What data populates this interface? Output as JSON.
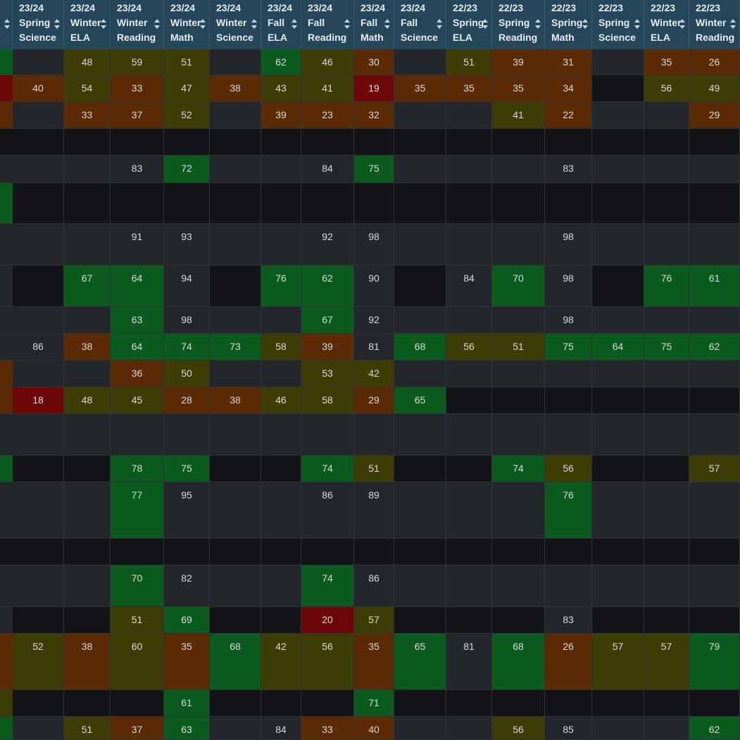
{
  "colors": {
    "empty": "#121417",
    "low": "#6e0808",
    "below": "#5a2b04",
    "mid": "#3f3d06",
    "high": "#0b5b1f",
    "avg": "#23272c",
    "header": "#26465a"
  },
  "columns": [
    {
      "term": "23/24",
      "season": "Spring",
      "subject": "Science"
    },
    {
      "term": "23/24",
      "season": "Winter",
      "subject": "ELA"
    },
    {
      "term": "23/24",
      "season": "Winter",
      "subject": "Reading"
    },
    {
      "term": "23/24",
      "season": "Winter",
      "subject": "Math"
    },
    {
      "term": "23/24",
      "season": "Winter",
      "subject": "Science"
    },
    {
      "term": "23/24",
      "season": "Fall",
      "subject": "ELA"
    },
    {
      "term": "23/24",
      "season": "Fall",
      "subject": "Reading"
    },
    {
      "term": "23/24",
      "season": "Fall",
      "subject": "Math"
    },
    {
      "term": "23/24",
      "season": "Fall",
      "subject": "Science"
    },
    {
      "term": "22/23",
      "season": "Spring",
      "subject": "ELA"
    },
    {
      "term": "22/23",
      "season": "Spring",
      "subject": "Reading"
    },
    {
      "term": "22/23",
      "season": "Spring",
      "subject": "Math"
    },
    {
      "term": "22/23",
      "season": "Spring",
      "subject": "Science"
    },
    {
      "term": "22/23",
      "season": "Winter",
      "subject": "ELA"
    },
    {
      "term": "22/23",
      "season": "Winter",
      "subject": "Reading"
    }
  ],
  "edge": [
    "high",
    "low",
    "below",
    "empty",
    "avg",
    "high",
    "avg",
    "avg",
    "avg",
    "avg",
    "below",
    "below",
    "avg",
    "high",
    "avg",
    "empty",
    "avg",
    "avg",
    "below",
    "mid",
    "high"
  ],
  "rows": [
    [
      [
        "",
        "avg"
      ],
      [
        "48",
        "mid"
      ],
      [
        "59",
        "mid"
      ],
      [
        "51",
        "mid"
      ],
      [
        "",
        "avg"
      ],
      [
        "62",
        "high"
      ],
      [
        "46",
        "mid"
      ],
      [
        "30",
        "below"
      ],
      [
        "",
        "avg"
      ],
      [
        "51",
        "mid"
      ],
      [
        "39",
        "below"
      ],
      [
        "31",
        "below"
      ],
      [
        "",
        "avg"
      ],
      [
        "35",
        "below"
      ],
      [
        "26",
        "below"
      ]
    ],
    [
      [
        "40",
        "below"
      ],
      [
        "54",
        "mid"
      ],
      [
        "33",
        "below"
      ],
      [
        "47",
        "mid"
      ],
      [
        "38",
        "below"
      ],
      [
        "43",
        "mid"
      ],
      [
        "41",
        "mid"
      ],
      [
        "19",
        "low"
      ],
      [
        "35",
        "below"
      ],
      [
        "35",
        "below"
      ],
      [
        "35",
        "below"
      ],
      [
        "34",
        "below"
      ],
      [
        "",
        "empty"
      ],
      [
        "56",
        "mid"
      ],
      [
        "49",
        "mid"
      ]
    ],
    [
      [
        "",
        "avg"
      ],
      [
        "33",
        "below"
      ],
      [
        "37",
        "below"
      ],
      [
        "52",
        "mid"
      ],
      [
        "",
        "avg"
      ],
      [
        "39",
        "below"
      ],
      [
        "23",
        "below"
      ],
      [
        "32",
        "below"
      ],
      [
        "",
        "avg"
      ],
      [
        "",
        "avg"
      ],
      [
        "41",
        "mid"
      ],
      [
        "22",
        "below"
      ],
      [
        "",
        "avg"
      ],
      [
        "",
        "avg"
      ],
      [
        "29",
        "below"
      ]
    ],
    [
      [
        "",
        "empty"
      ],
      [
        "",
        "empty"
      ],
      [
        "",
        "empty"
      ],
      [
        "",
        "empty"
      ],
      [
        "",
        "empty"
      ],
      [
        "",
        "empty"
      ],
      [
        "",
        "empty"
      ],
      [
        "",
        "empty"
      ],
      [
        "",
        "empty"
      ],
      [
        "",
        "empty"
      ],
      [
        "",
        "empty"
      ],
      [
        "",
        "empty"
      ],
      [
        "",
        "empty"
      ],
      [
        "",
        "empty"
      ],
      [
        "",
        "empty"
      ]
    ],
    [
      [
        "",
        "avg"
      ],
      [
        "",
        "avg"
      ],
      [
        "83",
        "avg"
      ],
      [
        "72",
        "high"
      ],
      [
        "",
        "avg"
      ],
      [
        "",
        "avg"
      ],
      [
        "84",
        "avg"
      ],
      [
        "75",
        "high"
      ],
      [
        "",
        "avg"
      ],
      [
        "",
        "avg"
      ],
      [
        "",
        "avg"
      ],
      [
        "83",
        "avg"
      ],
      [
        "",
        "avg"
      ],
      [
        "",
        "avg"
      ],
      [
        "",
        "avg"
      ]
    ],
    [
      [
        "",
        "empty"
      ],
      [
        "",
        "empty"
      ],
      [
        "",
        "empty"
      ],
      [
        "",
        "empty"
      ],
      [
        "",
        "empty"
      ],
      [
        "",
        "empty"
      ],
      [
        "",
        "empty"
      ],
      [
        "",
        "empty"
      ],
      [
        "",
        "empty"
      ],
      [
        "",
        "empty"
      ],
      [
        "",
        "empty"
      ],
      [
        "",
        "empty"
      ],
      [
        "",
        "empty"
      ],
      [
        "",
        "empty"
      ],
      [
        "",
        "empty"
      ]
    ],
    [
      [
        "",
        "avg"
      ],
      [
        "",
        "avg"
      ],
      [
        "91",
        "avg"
      ],
      [
        "93",
        "avg"
      ],
      [
        "",
        "avg"
      ],
      [
        "",
        "avg"
      ],
      [
        "92",
        "avg"
      ],
      [
        "98",
        "avg"
      ],
      [
        "",
        "avg"
      ],
      [
        "",
        "avg"
      ],
      [
        "",
        "avg"
      ],
      [
        "98",
        "avg"
      ],
      [
        "",
        "avg"
      ],
      [
        "",
        "avg"
      ],
      [
        "",
        "avg"
      ]
    ],
    [
      [
        "",
        "empty"
      ],
      [
        "67",
        "high"
      ],
      [
        "64",
        "high"
      ],
      [
        "94",
        "avg"
      ],
      [
        "",
        "empty"
      ],
      [
        "76",
        "high"
      ],
      [
        "62",
        "high"
      ],
      [
        "90",
        "avg"
      ],
      [
        "",
        "empty"
      ],
      [
        "84",
        "avg"
      ],
      [
        "70",
        "high"
      ],
      [
        "98",
        "avg"
      ],
      [
        "",
        "empty"
      ],
      [
        "76",
        "high"
      ],
      [
        "61",
        "high"
      ]
    ],
    [
      [
        "",
        "avg"
      ],
      [
        "",
        "avg"
      ],
      [
        "63",
        "high"
      ],
      [
        "98",
        "avg"
      ],
      [
        "",
        "avg"
      ],
      [
        "",
        "avg"
      ],
      [
        "67",
        "high"
      ],
      [
        "92",
        "avg"
      ],
      [
        "",
        "avg"
      ],
      [
        "",
        "avg"
      ],
      [
        "",
        "avg"
      ],
      [
        "98",
        "avg"
      ],
      [
        "",
        "avg"
      ],
      [
        "",
        "avg"
      ],
      [
        "",
        "avg"
      ]
    ],
    [
      [
        "86",
        "avg"
      ],
      [
        "38",
        "below"
      ],
      [
        "64",
        "high"
      ],
      [
        "74",
        "high"
      ],
      [
        "73",
        "high"
      ],
      [
        "58",
        "mid"
      ],
      [
        "39",
        "below"
      ],
      [
        "81",
        "avg"
      ],
      [
        "68",
        "high"
      ],
      [
        "56",
        "mid"
      ],
      [
        "51",
        "mid"
      ],
      [
        "75",
        "high"
      ],
      [
        "64",
        "high"
      ],
      [
        "75",
        "high"
      ],
      [
        "62",
        "high"
      ]
    ],
    [
      [
        "",
        "avg"
      ],
      [
        "",
        "avg"
      ],
      [
        "36",
        "below"
      ],
      [
        "50",
        "mid"
      ],
      [
        "",
        "avg"
      ],
      [
        "",
        "avg"
      ],
      [
        "53",
        "mid"
      ],
      [
        "42",
        "mid"
      ],
      [
        "",
        "avg"
      ],
      [
        "",
        "avg"
      ],
      [
        "",
        "avg"
      ],
      [
        "",
        "avg"
      ],
      [
        "",
        "avg"
      ],
      [
        "",
        "avg"
      ],
      [
        "",
        "avg"
      ]
    ],
    [
      [
        "18",
        "low"
      ],
      [
        "48",
        "mid"
      ],
      [
        "45",
        "mid"
      ],
      [
        "28",
        "below"
      ],
      [
        "38",
        "below"
      ],
      [
        "46",
        "mid"
      ],
      [
        "58",
        "mid"
      ],
      [
        "29",
        "below"
      ],
      [
        "65",
        "high"
      ],
      [
        "",
        "empty"
      ],
      [
        "",
        "empty"
      ],
      [
        "",
        "empty"
      ],
      [
        "",
        "empty"
      ],
      [
        "",
        "empty"
      ],
      [
        "",
        "empty"
      ]
    ],
    [
      [
        "",
        "avg"
      ],
      [
        "",
        "avg"
      ],
      [
        "",
        "avg"
      ],
      [
        "",
        "avg"
      ],
      [
        "",
        "avg"
      ],
      [
        "",
        "avg"
      ],
      [
        "",
        "avg"
      ],
      [
        "",
        "avg"
      ],
      [
        "",
        "avg"
      ],
      [
        "",
        "avg"
      ],
      [
        "",
        "avg"
      ],
      [
        "",
        "avg"
      ],
      [
        "",
        "avg"
      ],
      [
        "",
        "avg"
      ],
      [
        "",
        "avg"
      ]
    ],
    [
      [
        "",
        "empty"
      ],
      [
        "",
        "empty"
      ],
      [
        "78",
        "high"
      ],
      [
        "75",
        "high"
      ],
      [
        "",
        "empty"
      ],
      [
        "",
        "empty"
      ],
      [
        "74",
        "high"
      ],
      [
        "51",
        "mid"
      ],
      [
        "",
        "empty"
      ],
      [
        "",
        "empty"
      ],
      [
        "74",
        "high"
      ],
      [
        "56",
        "mid"
      ],
      [
        "",
        "empty"
      ],
      [
        "",
        "empty"
      ],
      [
        "57",
        "mid"
      ]
    ],
    [
      [
        "",
        "avg"
      ],
      [
        "",
        "avg"
      ],
      [
        "77",
        "high"
      ],
      [
        "95",
        "avg"
      ],
      [
        "",
        "avg"
      ],
      [
        "",
        "avg"
      ],
      [
        "86",
        "avg"
      ],
      [
        "89",
        "avg"
      ],
      [
        "",
        "avg"
      ],
      [
        "",
        "avg"
      ],
      [
        "",
        "avg"
      ],
      [
        "76",
        "high"
      ],
      [
        "",
        "avg"
      ],
      [
        "",
        "avg"
      ],
      [
        "",
        "avg"
      ]
    ],
    [
      [
        "",
        "empty"
      ],
      [
        "",
        "empty"
      ],
      [
        "",
        "empty"
      ],
      [
        "",
        "empty"
      ],
      [
        "",
        "empty"
      ],
      [
        "",
        "empty"
      ],
      [
        "",
        "empty"
      ],
      [
        "",
        "empty"
      ],
      [
        "",
        "empty"
      ],
      [
        "",
        "empty"
      ],
      [
        "",
        "empty"
      ],
      [
        "",
        "empty"
      ],
      [
        "",
        "empty"
      ],
      [
        "",
        "empty"
      ],
      [
        "",
        "empty"
      ]
    ],
    [
      [
        "",
        "avg"
      ],
      [
        "",
        "avg"
      ],
      [
        "70",
        "high"
      ],
      [
        "82",
        "avg"
      ],
      [
        "",
        "avg"
      ],
      [
        "",
        "avg"
      ],
      [
        "74",
        "high"
      ],
      [
        "86",
        "avg"
      ],
      [
        "",
        "avg"
      ],
      [
        "",
        "avg"
      ],
      [
        "",
        "avg"
      ],
      [
        "",
        "avg"
      ],
      [
        "",
        "avg"
      ],
      [
        "",
        "avg"
      ],
      [
        "",
        "avg"
      ]
    ],
    [
      [
        "",
        "empty"
      ],
      [
        "",
        "empty"
      ],
      [
        "51",
        "mid"
      ],
      [
        "69",
        "high"
      ],
      [
        "",
        "empty"
      ],
      [
        "",
        "empty"
      ],
      [
        "20",
        "low"
      ],
      [
        "57",
        "mid"
      ],
      [
        "",
        "empty"
      ],
      [
        "",
        "empty"
      ],
      [
        "",
        "empty"
      ],
      [
        "83",
        "avg"
      ],
      [
        "",
        "empty"
      ],
      [
        "",
        "empty"
      ],
      [
        "",
        "empty"
      ]
    ],
    [
      [
        "52",
        "mid"
      ],
      [
        "38",
        "below"
      ],
      [
        "60",
        "mid"
      ],
      [
        "35",
        "below"
      ],
      [
        "68",
        "high"
      ],
      [
        "42",
        "mid"
      ],
      [
        "56",
        "mid"
      ],
      [
        "35",
        "below"
      ],
      [
        "65",
        "high"
      ],
      [
        "81",
        "avg"
      ],
      [
        "68",
        "high"
      ],
      [
        "26",
        "below"
      ],
      [
        "57",
        "mid"
      ],
      [
        "57",
        "mid"
      ],
      [
        "79",
        "high"
      ]
    ],
    [
      [
        "",
        "empty"
      ],
      [
        "",
        "empty"
      ],
      [
        "",
        "empty"
      ],
      [
        "61",
        "high"
      ],
      [
        "",
        "empty"
      ],
      [
        "",
        "empty"
      ],
      [
        "",
        "empty"
      ],
      [
        "71",
        "high"
      ],
      [
        "",
        "empty"
      ],
      [
        "",
        "empty"
      ],
      [
        "",
        "empty"
      ],
      [
        "",
        "empty"
      ],
      [
        "",
        "empty"
      ],
      [
        "",
        "empty"
      ],
      [
        "",
        "empty"
      ]
    ],
    [
      [
        "",
        "avg"
      ],
      [
        "51",
        "mid"
      ],
      [
        "37",
        "below"
      ],
      [
        "63",
        "high"
      ],
      [
        "",
        "avg"
      ],
      [
        "84",
        "avg"
      ],
      [
        "33",
        "below"
      ],
      [
        "40",
        "below"
      ],
      [
        "",
        "avg"
      ],
      [
        "",
        "avg"
      ],
      [
        "56",
        "mid"
      ],
      [
        "85",
        "avg"
      ],
      [
        "",
        "avg"
      ],
      [
        "",
        "avg"
      ],
      [
        "62",
        "high"
      ]
    ]
  ]
}
